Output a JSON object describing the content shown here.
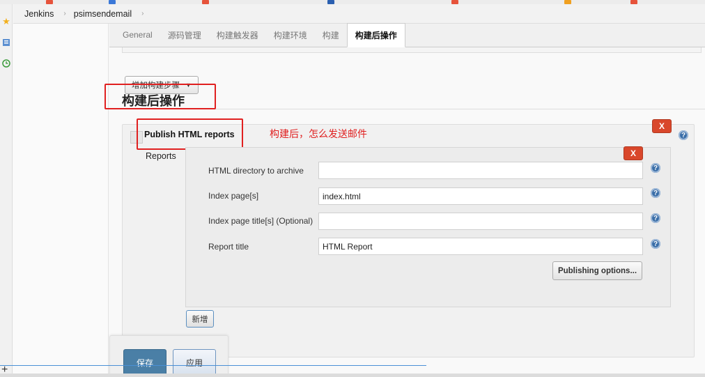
{
  "breadcrumb": [
    "Jenkins",
    "psimsendemail"
  ],
  "tabs": [
    "General",
    "源码管理",
    "构建触发器",
    "构建环境",
    "构建",
    "构建后操作"
  ],
  "active_tab_index": 5,
  "add_build_step_label": "增加构建步骤",
  "section_title": "构建后操作",
  "publisher": {
    "title": "Publish HTML reports",
    "annotation": "构建后，怎么发送邮件",
    "reports_label": "Reports",
    "delete_label": "X",
    "fields": [
      {
        "label": "HTML directory to archive",
        "value": ""
      },
      {
        "label": "Index page[s]",
        "value": "index.html"
      },
      {
        "label": "Index page title[s] (Optional)",
        "value": ""
      },
      {
        "label": "Report title",
        "value": "HTML Report"
      }
    ],
    "publishing_options_label": "Publishing options...",
    "add_label": "新增"
  },
  "help_glyph": "?",
  "buttons": {
    "save": "保存",
    "apply": "应用"
  },
  "colors": {
    "delete_red": "#d9472b",
    "annotation_red": "#e02020",
    "primary_blue": "#4a7fa6"
  }
}
